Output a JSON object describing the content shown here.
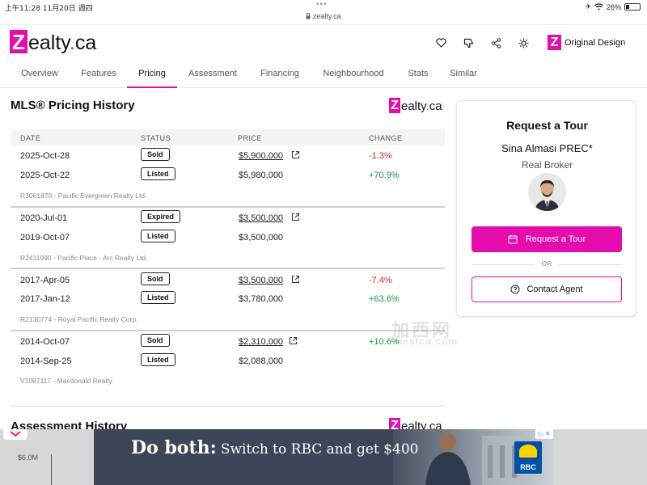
{
  "status_bar": {
    "time": "上午11:28",
    "date": "11月20日 週四",
    "url": "zealty.ca",
    "battery": "26%"
  },
  "header": {
    "logo_letter": "Z",
    "logo_text": "ealty",
    "logo_dot": ".",
    "logo_suffix": "ca",
    "original_design_letter": "Z",
    "original_design_label": "Original Design"
  },
  "nav": {
    "tabs": [
      {
        "label": "Overview"
      },
      {
        "label": "Features"
      },
      {
        "label": "Pricing"
      },
      {
        "label": "Assessment"
      },
      {
        "label": "Financing"
      },
      {
        "label": "Neighbourhood"
      },
      {
        "label": "Stats"
      },
      {
        "label": "Similar"
      }
    ],
    "active": "Pricing"
  },
  "pricing_history": {
    "title": "MLS® Pricing History",
    "columns": {
      "date": "DATE",
      "status": "STATUS",
      "price": "PRICE",
      "change": "CHANGE"
    },
    "groups": [
      {
        "rows": [
          {
            "date": "2025-Oct-28",
            "status": "Sold",
            "price": "$5,900,000",
            "change": "-1.3%"
          },
          {
            "date": "2025-Oct-22",
            "status": "Listed",
            "price": "$5,980,000",
            "change": "+70.9%"
          }
        ],
        "broker": "R3061870 - Pacific Evergreen Realty Ltd."
      },
      {
        "rows": [
          {
            "date": "2020-Jul-01",
            "status": "Expired",
            "price": "$3,500,000",
            "change": ""
          },
          {
            "date": "2019-Oct-07",
            "status": "Listed",
            "price": "$3,500,000",
            "change": ""
          }
        ],
        "broker": "R2411990 - Pacific Place - Arc Realty Ltd."
      },
      {
        "rows": [
          {
            "date": "2017-Apr-05",
            "status": "Sold",
            "price": "$3,500,000",
            "change": "-7.4%"
          },
          {
            "date": "2017-Jan-12",
            "status": "Listed",
            "price": "$3,780,000",
            "change": "+63.6%"
          }
        ],
        "broker": "R2130774 - Royal Pacific Realty Corp."
      },
      {
        "rows": [
          {
            "date": "2014-Oct-07",
            "status": "Sold",
            "price": "$2,310,000",
            "change": "+10.6%"
          },
          {
            "date": "2014-Sep-25",
            "status": "Listed",
            "price": "$2,088,000",
            "change": ""
          }
        ],
        "broker": "V1087117 - Macdonald Realty"
      }
    ]
  },
  "assessment_history": {
    "title": "Assessment History",
    "y_label": "$6.0M"
  },
  "tour_card": {
    "title": "Request a Tour",
    "agent_name": "Sina Almasi PREC*",
    "agent_role": "Real Broker",
    "request_button": "Request a Tour",
    "or_label": "OR",
    "contact_button": "Contact Agent"
  },
  "watermark": {
    "line1": "加西网",
    "line2": "westca.com"
  },
  "ad": {
    "headline_bold": "Do both:",
    "headline_rest": "Switch to RBC and get $400",
    "brand": "RBC"
  },
  "colors": {
    "brand": "#e40cad",
    "negative": "#d0282a",
    "positive": "#14973e"
  }
}
